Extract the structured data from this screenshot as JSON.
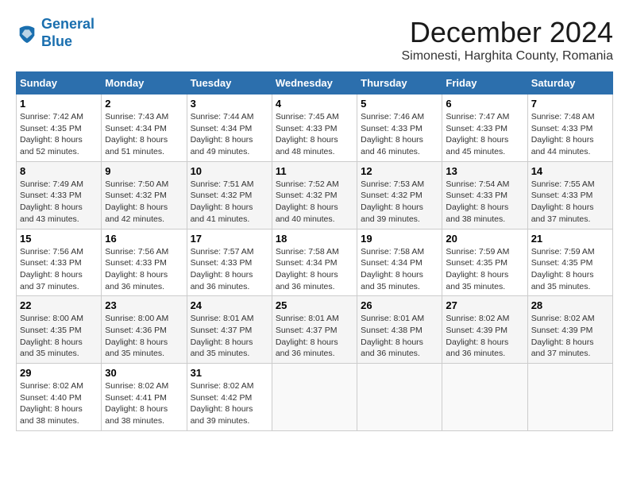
{
  "header": {
    "logo_line1": "General",
    "logo_line2": "Blue",
    "month_title": "December 2024",
    "location": "Simonesti, Harghita County, Romania"
  },
  "columns": [
    "Sunday",
    "Monday",
    "Tuesday",
    "Wednesday",
    "Thursday",
    "Friday",
    "Saturday"
  ],
  "weeks": [
    [
      {
        "day": "1",
        "sunrise": "7:42 AM",
        "sunset": "4:35 PM",
        "daylight": "8 hours and 52 minutes."
      },
      {
        "day": "2",
        "sunrise": "7:43 AM",
        "sunset": "4:34 PM",
        "daylight": "8 hours and 51 minutes."
      },
      {
        "day": "3",
        "sunrise": "7:44 AM",
        "sunset": "4:34 PM",
        "daylight": "8 hours and 49 minutes."
      },
      {
        "day": "4",
        "sunrise": "7:45 AM",
        "sunset": "4:33 PM",
        "daylight": "8 hours and 48 minutes."
      },
      {
        "day": "5",
        "sunrise": "7:46 AM",
        "sunset": "4:33 PM",
        "daylight": "8 hours and 46 minutes."
      },
      {
        "day": "6",
        "sunrise": "7:47 AM",
        "sunset": "4:33 PM",
        "daylight": "8 hours and 45 minutes."
      },
      {
        "day": "7",
        "sunrise": "7:48 AM",
        "sunset": "4:33 PM",
        "daylight": "8 hours and 44 minutes."
      }
    ],
    [
      {
        "day": "8",
        "sunrise": "7:49 AM",
        "sunset": "4:33 PM",
        "daylight": "8 hours and 43 minutes."
      },
      {
        "day": "9",
        "sunrise": "7:50 AM",
        "sunset": "4:32 PM",
        "daylight": "8 hours and 42 minutes."
      },
      {
        "day": "10",
        "sunrise": "7:51 AM",
        "sunset": "4:32 PM",
        "daylight": "8 hours and 41 minutes."
      },
      {
        "day": "11",
        "sunrise": "7:52 AM",
        "sunset": "4:32 PM",
        "daylight": "8 hours and 40 minutes."
      },
      {
        "day": "12",
        "sunrise": "7:53 AM",
        "sunset": "4:32 PM",
        "daylight": "8 hours and 39 minutes."
      },
      {
        "day": "13",
        "sunrise": "7:54 AM",
        "sunset": "4:33 PM",
        "daylight": "8 hours and 38 minutes."
      },
      {
        "day": "14",
        "sunrise": "7:55 AM",
        "sunset": "4:33 PM",
        "daylight": "8 hours and 37 minutes."
      }
    ],
    [
      {
        "day": "15",
        "sunrise": "7:56 AM",
        "sunset": "4:33 PM",
        "daylight": "8 hours and 37 minutes."
      },
      {
        "day": "16",
        "sunrise": "7:56 AM",
        "sunset": "4:33 PM",
        "daylight": "8 hours and 36 minutes."
      },
      {
        "day": "17",
        "sunrise": "7:57 AM",
        "sunset": "4:33 PM",
        "daylight": "8 hours and 36 minutes."
      },
      {
        "day": "18",
        "sunrise": "7:58 AM",
        "sunset": "4:34 PM",
        "daylight": "8 hours and 36 minutes."
      },
      {
        "day": "19",
        "sunrise": "7:58 AM",
        "sunset": "4:34 PM",
        "daylight": "8 hours and 35 minutes."
      },
      {
        "day": "20",
        "sunrise": "7:59 AM",
        "sunset": "4:35 PM",
        "daylight": "8 hours and 35 minutes."
      },
      {
        "day": "21",
        "sunrise": "7:59 AM",
        "sunset": "4:35 PM",
        "daylight": "8 hours and 35 minutes."
      }
    ],
    [
      {
        "day": "22",
        "sunrise": "8:00 AM",
        "sunset": "4:35 PM",
        "daylight": "8 hours and 35 minutes."
      },
      {
        "day": "23",
        "sunrise": "8:00 AM",
        "sunset": "4:36 PM",
        "daylight": "8 hours and 35 minutes."
      },
      {
        "day": "24",
        "sunrise": "8:01 AM",
        "sunset": "4:37 PM",
        "daylight": "8 hours and 35 minutes."
      },
      {
        "day": "25",
        "sunrise": "8:01 AM",
        "sunset": "4:37 PM",
        "daylight": "8 hours and 36 minutes."
      },
      {
        "day": "26",
        "sunrise": "8:01 AM",
        "sunset": "4:38 PM",
        "daylight": "8 hours and 36 minutes."
      },
      {
        "day": "27",
        "sunrise": "8:02 AM",
        "sunset": "4:39 PM",
        "daylight": "8 hours and 36 minutes."
      },
      {
        "day": "28",
        "sunrise": "8:02 AM",
        "sunset": "4:39 PM",
        "daylight": "8 hours and 37 minutes."
      }
    ],
    [
      {
        "day": "29",
        "sunrise": "8:02 AM",
        "sunset": "4:40 PM",
        "daylight": "8 hours and 38 minutes."
      },
      {
        "day": "30",
        "sunrise": "8:02 AM",
        "sunset": "4:41 PM",
        "daylight": "8 hours and 38 minutes."
      },
      {
        "day": "31",
        "sunrise": "8:02 AM",
        "sunset": "4:42 PM",
        "daylight": "8 hours and 39 minutes."
      },
      null,
      null,
      null,
      null
    ]
  ]
}
